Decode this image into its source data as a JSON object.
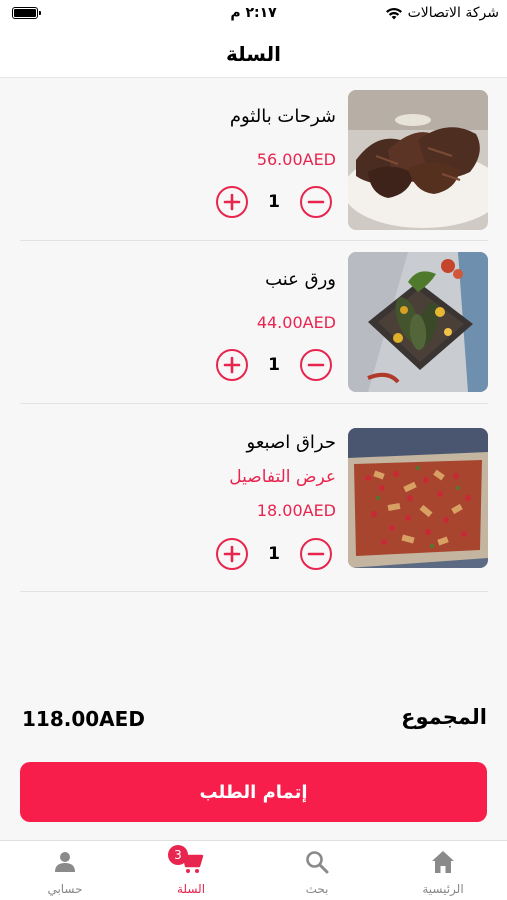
{
  "status_bar": {
    "time": "٢:١٧ م",
    "carrier": "شركة الاتصالات"
  },
  "header": {
    "title": "السلة"
  },
  "cart": {
    "items": [
      {
        "name": "شرحات بالثوم",
        "price": "56.00AED",
        "quantity": "1",
        "image_icon": "garlic-steak-photo"
      },
      {
        "name": "ورق عنب",
        "price": "44.00AED",
        "quantity": "1",
        "image_icon": "grape-leaves-photo"
      },
      {
        "name": "حراق اصبعو",
        "details_link": "عرض التفاصيل",
        "price": "18.00AED",
        "quantity": "1",
        "image_icon": "harak-osbao-photo"
      }
    ]
  },
  "summary": {
    "total_label": "المجموع",
    "total_value": "118.00AED"
  },
  "checkout": {
    "label": "إتمام الطلب"
  },
  "tabbar": {
    "items": [
      {
        "label": "حسابي",
        "icon": "person-icon"
      },
      {
        "label": "السلة",
        "icon": "cart-icon",
        "badge": "3",
        "active": true
      },
      {
        "label": "بحث",
        "icon": "search-icon"
      },
      {
        "label": "الرئيسية",
        "icon": "home-icon"
      }
    ]
  },
  "colors": {
    "accent": "#e8254f",
    "checkout_button": "#f81e4b",
    "background": "#f7f7f7"
  }
}
